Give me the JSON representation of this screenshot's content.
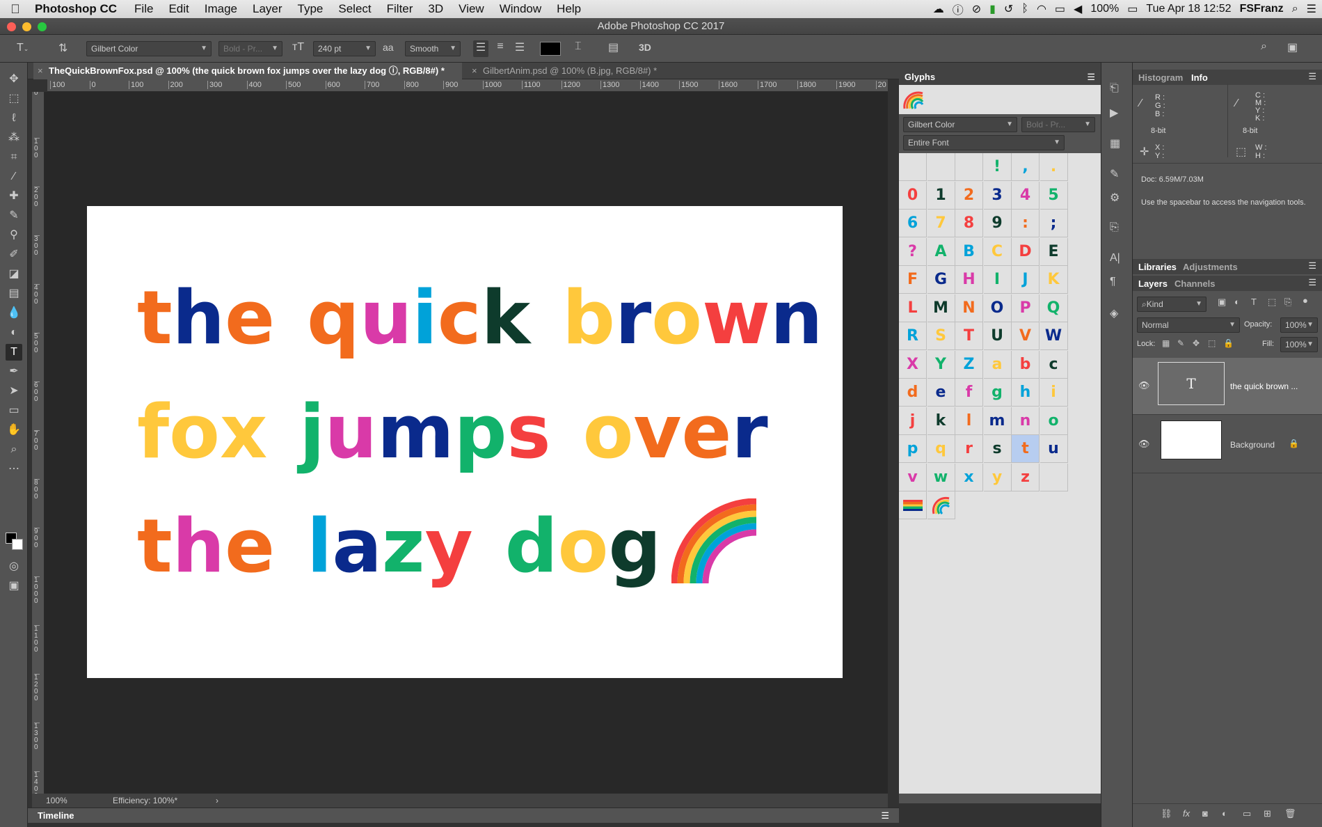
{
  "menubar": {
    "apple": "",
    "app": "Photoshop CC",
    "items": [
      "File",
      "Edit",
      "Image",
      "Layer",
      "Type",
      "Select",
      "Filter",
      "3D",
      "View",
      "Window",
      "Help"
    ],
    "battery": "100%",
    "datetime": "Tue Apr 18  12:52",
    "user": "FSFranz"
  },
  "window": {
    "title": "Adobe Photoshop CC 2017"
  },
  "options": {
    "font_family": "Gilbert Color",
    "font_style": "Bold - Pr...",
    "font_size": "240 pt",
    "aa_label": "aa",
    "antialias": "Smooth",
    "threed": "3D",
    "color": "#000000"
  },
  "tabs": [
    {
      "label": "TheQuickBrownFox.psd @ 100% (the quick brown  fox jumps over the lazy dog ⓘ, RGB/8#) *"
    },
    {
      "label": "GilbertAnim.psd @ 100% (B.jpg, RGB/8#) *"
    }
  ],
  "ruler": {
    "h": [
      "100",
      "0",
      "100",
      "200",
      "300",
      "400",
      "500",
      "600",
      "700",
      "800",
      "900",
      "1000",
      "1100",
      "1200",
      "1300",
      "1400",
      "1500",
      "1600",
      "1700",
      "1800",
      "1900",
      "20"
    ],
    "v": [
      "0",
      "100",
      "200",
      "300",
      "400",
      "500",
      "600",
      "700",
      "800",
      "900",
      "1000",
      "1100",
      "1200",
      "1300",
      "1400"
    ]
  },
  "canvas": {
    "lines": [
      [
        [
          "t",
          "#f26b1d"
        ],
        [
          "h",
          "#0a2a8c"
        ],
        [
          "e",
          "#f26b1d"
        ],
        [
          " ",
          ""
        ],
        [
          "q",
          "#f26b1d"
        ],
        [
          "u",
          "#d93aa8"
        ],
        [
          "i",
          "#00a2d9"
        ],
        [
          "c",
          "#f26b1d"
        ],
        [
          "k",
          "#0e3b2c"
        ],
        [
          " ",
          ""
        ],
        [
          "b",
          "#ffc83c"
        ],
        [
          "r",
          "#0a2a8c"
        ],
        [
          "o",
          "#ffc83c"
        ],
        [
          "w",
          "#f43f3f"
        ],
        [
          "n",
          "#0a2a8c"
        ]
      ],
      [
        [
          "f",
          "#ffc83c"
        ],
        [
          "o",
          "#ffc83c"
        ],
        [
          "x",
          "#ffc83c"
        ],
        [
          " ",
          ""
        ],
        [
          "j",
          "#12b26b"
        ],
        [
          "u",
          "#d93aa8"
        ],
        [
          "m",
          "#0a2a8c"
        ],
        [
          "p",
          "#12b26b"
        ],
        [
          "s",
          "#f43f3f"
        ],
        [
          " ",
          ""
        ],
        [
          "o",
          "#ffc83c"
        ],
        [
          "v",
          "#f26b1d"
        ],
        [
          "e",
          "#f26b1d"
        ],
        [
          "r",
          "#0a2a8c"
        ]
      ],
      [
        [
          "t",
          "#f26b1d"
        ],
        [
          "h",
          "#d93aa8"
        ],
        [
          "e",
          "#f26b1d"
        ],
        [
          " ",
          ""
        ],
        [
          "l",
          "#00a2d9"
        ],
        [
          "a",
          "#0a2a8c"
        ],
        [
          "z",
          "#12b26b"
        ],
        [
          "y",
          "#f43f3f"
        ],
        [
          " ",
          ""
        ],
        [
          "d",
          "#12b26b"
        ],
        [
          "o",
          "#ffc83c"
        ],
        [
          "g",
          "#0e3b2c"
        ]
      ]
    ]
  },
  "status": {
    "zoom": "100%",
    "efficiency": "Efficiency: 100%*",
    "arrow": "›"
  },
  "timeline": {
    "label": "Timeline"
  },
  "glyphs": {
    "title": "Glyphs",
    "font": "Gilbert Color",
    "style": "Bold - Pr...",
    "subset": "Entire Font",
    "cells": [
      [
        "",
        "",
        "",
        "!",
        ",",
        "."
      ],
      [
        "0",
        "1",
        "2",
        "3",
        "4",
        "5"
      ],
      [
        "6",
        "7",
        "8",
        "9",
        ":",
        ";"
      ],
      [
        "?",
        "A",
        "B",
        "C",
        "D",
        "E"
      ],
      [
        "F",
        "G",
        "H",
        "I",
        "J",
        "K"
      ],
      [
        "L",
        "M",
        "N",
        "O",
        "P",
        "Q"
      ],
      [
        "R",
        "S",
        "T",
        "U",
        "V",
        "W"
      ],
      [
        "X",
        "Y",
        "Z",
        "a",
        "b",
        "c"
      ],
      [
        "d",
        "e",
        "f",
        "g",
        "h",
        "i"
      ],
      [
        "j",
        "k",
        "l",
        "m",
        "n",
        "o"
      ],
      [
        "p",
        "q",
        "r",
        "s",
        "t",
        "u"
      ],
      [
        "v",
        "w",
        "x",
        "y",
        "z",
        ""
      ]
    ],
    "palette": [
      "#f26b1d",
      "#0a2a8c",
      "#d93aa8",
      "#12b26b",
      "#00a2d9",
      "#ffc83c",
      "#f43f3f",
      "#0e3b2c"
    ]
  },
  "info": {
    "tab_histogram": "Histogram",
    "tab_info": "Info",
    "rgb": "R :\nG :\nB :",
    "cmyk": "C :\nM :\nY :\nK :",
    "bit1": "8-bit",
    "bit2": "8-bit",
    "xy": "X :\nY :",
    "wh": "W :\nH :",
    "doc": "Doc: 6.59M/7.03M",
    "hint": "Use the spacebar to access the navigation tools."
  },
  "libraries": {
    "tab1": "Libraries",
    "tab2": "Adjustments"
  },
  "layers": {
    "tab1": "Layers",
    "tab2": "Channels",
    "kind": "Kind",
    "blend": "Normal",
    "opacity_label": "Opacity:",
    "opacity": "100%",
    "lock_label": "Lock:",
    "fill_label": "Fill:",
    "fill": "100%",
    "rows": [
      {
        "name": "the quick brown ...",
        "thumb": "T"
      },
      {
        "name": "Background"
      }
    ]
  }
}
